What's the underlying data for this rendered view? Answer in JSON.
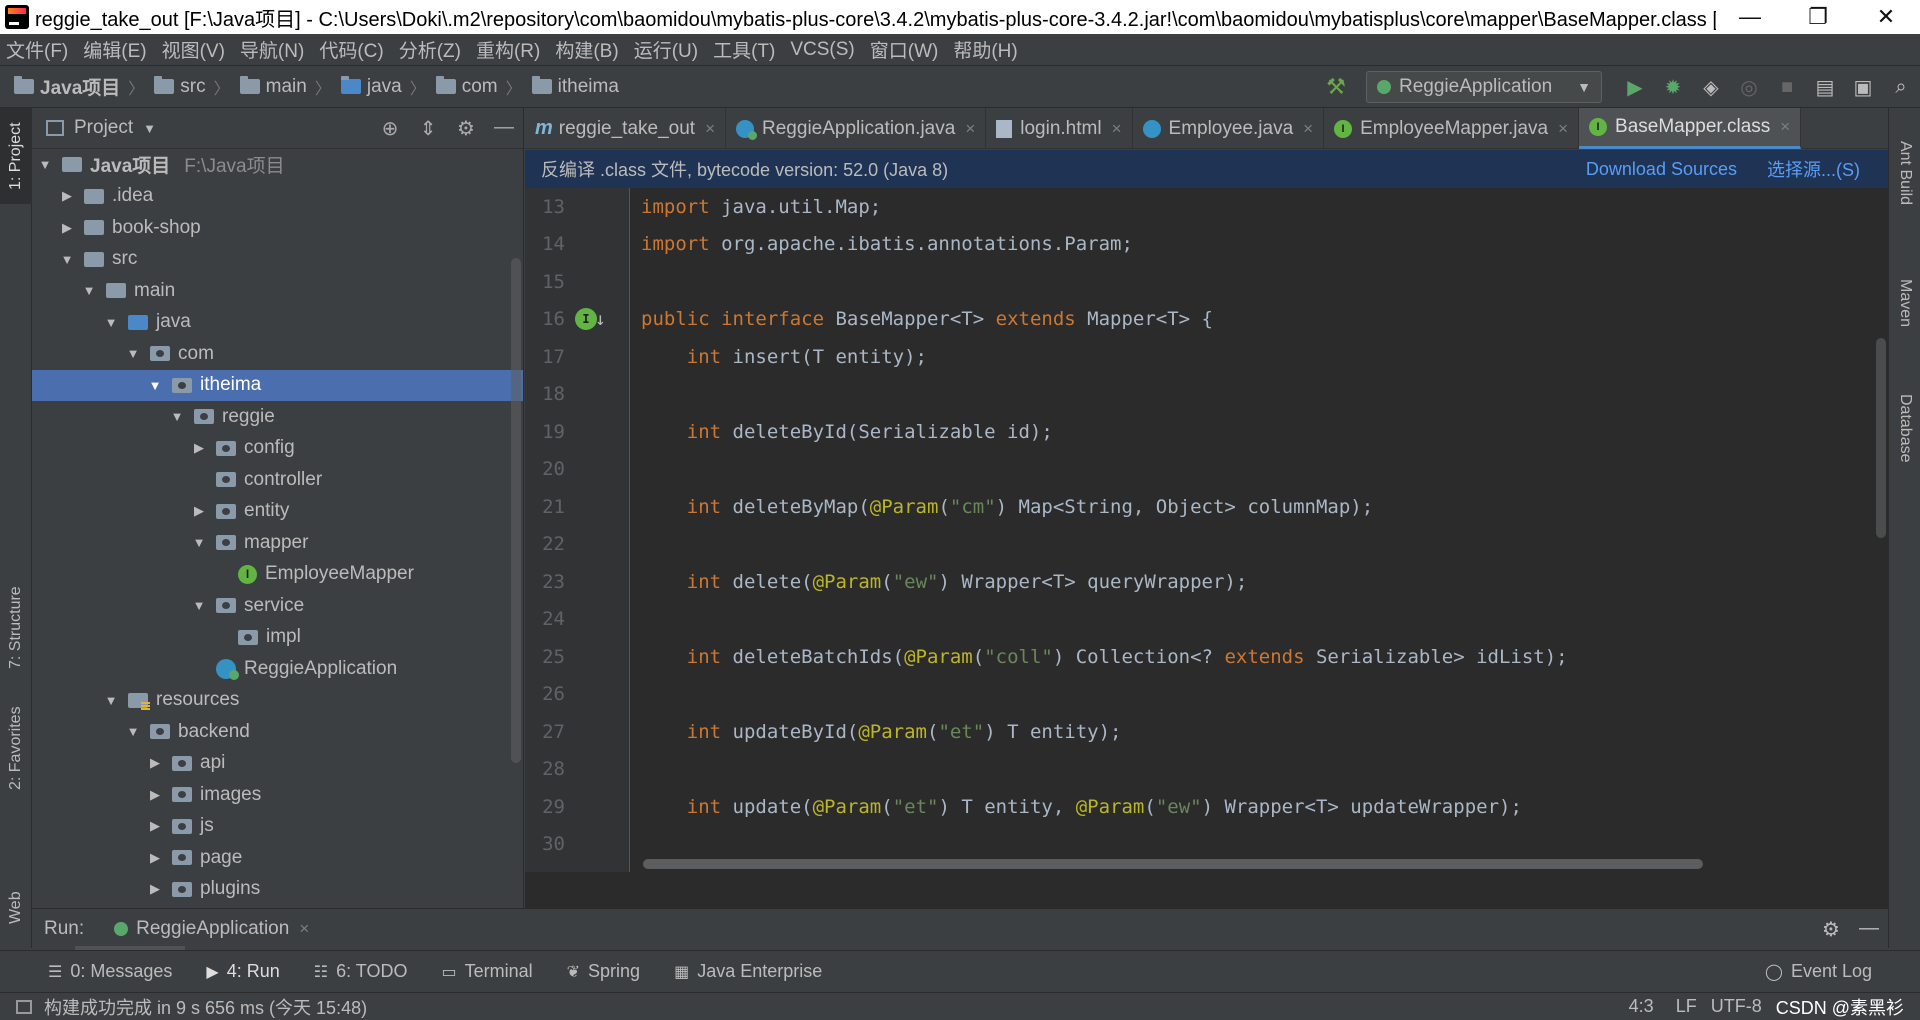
{
  "window": {
    "title": "reggie_take_out [F:\\Java项目] - C:\\Users\\Doki\\.m2\\repository\\com\\baomidou\\mybatis-plus-core\\3.4.2\\mybatis-plus-core-3.4.2.jar!\\com\\baomidou\\mybatisplus\\core\\mapper\\BaseMapper.class [...",
    "minimize": "—",
    "restore": "❐",
    "close": "✕"
  },
  "menu": [
    "文件(F)",
    "编辑(E)",
    "视图(V)",
    "导航(N)",
    "代码(C)",
    "分析(Z)",
    "重构(R)",
    "构建(B)",
    "运行(U)",
    "工具(T)",
    "VCS(S)",
    "窗口(W)",
    "帮助(H)"
  ],
  "breadcrumbs": [
    "Java项目",
    "src",
    "main",
    "java",
    "com",
    "itheima"
  ],
  "run_config": "ReggieApplication",
  "left_stripe": {
    "project": "1: Project",
    "structure": "7: Structure",
    "favorites": "2: Favorites",
    "web": "Web"
  },
  "right_stripe": {
    "ant": "Ant Build",
    "maven": "Maven",
    "database": "Database"
  },
  "project_panel": {
    "title": "Project",
    "tree": [
      {
        "label": "Java项目",
        "path": "F:\\Java项目",
        "bold": true
      },
      {
        "label": ".idea"
      },
      {
        "label": "book-shop"
      },
      {
        "label": "src"
      },
      {
        "label": "main"
      },
      {
        "label": "java"
      },
      {
        "label": "com"
      },
      {
        "label": "itheima"
      },
      {
        "label": "reggie"
      },
      {
        "label": "config"
      },
      {
        "label": "controller"
      },
      {
        "label": "entity"
      },
      {
        "label": "mapper"
      },
      {
        "label": "EmployeeMapper"
      },
      {
        "label": "service"
      },
      {
        "label": "impl"
      },
      {
        "label": "ReggieApplication"
      },
      {
        "label": "resources"
      },
      {
        "label": "backend"
      },
      {
        "label": "api"
      },
      {
        "label": "images"
      },
      {
        "label": "js"
      },
      {
        "label": "page"
      },
      {
        "label": "plugins"
      }
    ]
  },
  "tabs": [
    {
      "label": "reggie_take_out"
    },
    {
      "label": "ReggieApplication.java"
    },
    {
      "label": "login.html"
    },
    {
      "label": "Employee.java"
    },
    {
      "label": "EmployeeMapper.java"
    },
    {
      "label": "BaseMapper.class"
    }
  ],
  "banner": {
    "text": "反编译 .class 文件, bytecode version: 52.0 (Java 8)",
    "download": "Download Sources",
    "choose": "选择源...(S)"
  },
  "code": {
    "line_numbers": [
      "13",
      "14",
      "15",
      "16",
      "17",
      "18",
      "19",
      "20",
      "21",
      "22",
      "23",
      "24",
      "25",
      "26",
      "27",
      "28",
      "29",
      "30"
    ],
    "l13a": "import",
    "l13b": " java.util.Map;",
    "l14a": "import",
    "l14b": " org.apache.ibatis.annotations.Param;",
    "l16a": "public interface",
    "l16b": " BaseMapper<T> ",
    "l16c": "extends",
    "l16d": " Mapper<T> {",
    "l17a": "    int",
    "l17b": " insert(T entity);",
    "l19a": "    int",
    "l19b": " deleteById(Serializable id);",
    "l21a": "    int",
    "l21b": " deleteByMap(",
    "l21c": "@Param",
    "l21d": "(",
    "l21e": "\"cm\"",
    "l21f": ") Map<String, Object> columnMap);",
    "l23a": "    int",
    "l23b": " delete(",
    "l23c": "@Param",
    "l23d": "(",
    "l23e": "\"ew\"",
    "l23f": ") Wrapper<T> queryWrapper);",
    "l25a": "    int",
    "l25b": " deleteBatchIds(",
    "l25c": "@Param",
    "l25d": "(",
    "l25e": "\"coll\"",
    "l25f": ") Collection<? ",
    "l25g": "extends",
    "l25h": " Serializable> idList);",
    "l27a": "    int",
    "l27b": " updateById(",
    "l27c": "@Param",
    "l27d": "(",
    "l27e": "\"et\"",
    "l27f": ") T entity);",
    "l29a": "    int",
    "l29b": " update(",
    "l29c": "@Param",
    "l29d": "(",
    "l29e": "\"et\"",
    "l29f": ") T entity, ",
    "l29g": "@Param",
    "l29h": "(",
    "l29i": "\"ew\"",
    "l29j": ") Wrapper<T> updateWrapper);"
  },
  "run_panel": {
    "label": "Run:",
    "tab": "ReggieApplication"
  },
  "bottom_tabs": [
    {
      "label": "0: Messages"
    },
    {
      "label": "4: Run"
    },
    {
      "label": "6: TODO"
    },
    {
      "label": "Terminal"
    },
    {
      "label": "Spring"
    },
    {
      "label": "Java Enterprise"
    }
  ],
  "event_log": "Event Log",
  "status": {
    "message": "构建成功完成 in 9 s 656 ms (今天 15:48)",
    "position": "4:3",
    "line_sep": "LF",
    "encoding": "UTF-8",
    "watermark": "CSDN @素黑衫"
  },
  "colors": {
    "selection": "#4b6eaf",
    "keyword": "#cc7832",
    "string": "#6a8759",
    "annotation": "#bbb529",
    "link": "#589df6"
  }
}
